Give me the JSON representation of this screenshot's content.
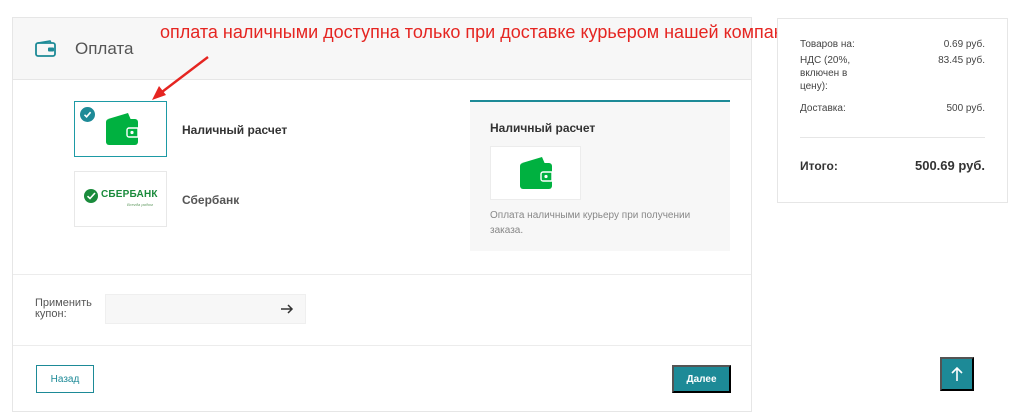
{
  "colors": {
    "accent": "#1d8a97",
    "wallet_green": "#00b140",
    "annotation": "#e52521"
  },
  "payment": {
    "title": "Оплата",
    "header_icon": "wallet-icon",
    "methods": [
      {
        "label": "Наличный расчет",
        "icon": "wallet-icon",
        "selected": true
      },
      {
        "label": "Сбербанк",
        "icon": "sberbank-logo",
        "logo_text": "СБЕРБАНК",
        "slogan": "Всегда рядом",
        "selected": false
      }
    ],
    "info": {
      "title": "Наличный расчет",
      "icon": "wallet-icon",
      "description": "Оплата наличными курьеру при получении заказа."
    },
    "coupon": {
      "label": "Применить купон:",
      "value": "",
      "submit_icon": "arrow-right-icon"
    },
    "back_label": "Назад",
    "next_label": "Далее"
  },
  "annotation": {
    "text": "оплата наличными доступна только при доставке курьером нашей компании"
  },
  "summary": {
    "rows": [
      {
        "label": "Товаров на:",
        "value": "0.69 руб."
      },
      {
        "label": "НДС (20%, включен в цену):",
        "value": "83.45 руб."
      },
      {
        "label": "Доставка:",
        "value": "500 руб."
      }
    ],
    "total_label": "Итого:",
    "total_value": "500.69 руб."
  },
  "scroll_top_icon": "arrow-up-icon"
}
